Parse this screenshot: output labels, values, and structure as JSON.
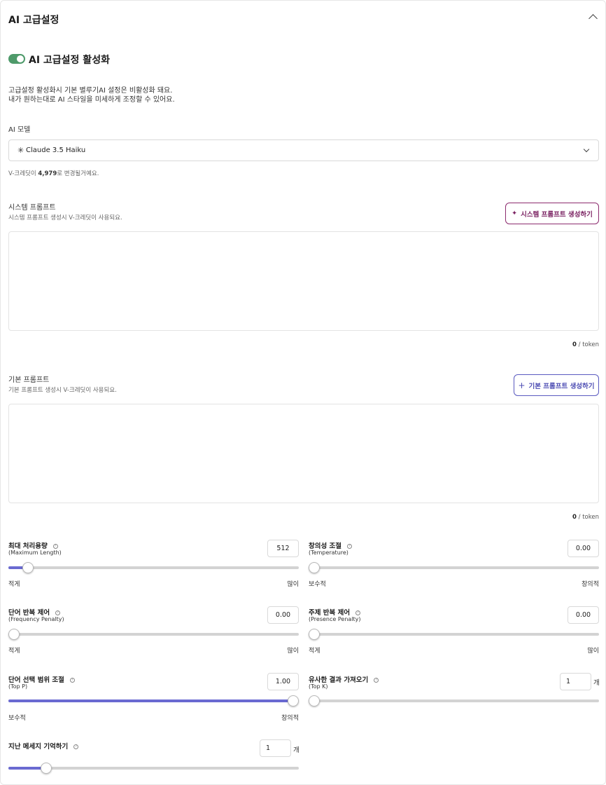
{
  "header": {
    "title": "AI 고급설정"
  },
  "toggle": {
    "label": "AI 고급설정 활성화",
    "on": true
  },
  "description": {
    "line1": "고급설정 활성화시 기본 별루기AI 설정은 비활성화 돼요.",
    "line2": "내가 원하는대로 AI 스타일을 미세하게 조정할 수 있어요."
  },
  "model": {
    "label": "AI 모델",
    "selected": "Claude 3.5 Haiku",
    "credit_prefix": "V-크레딧이 ",
    "credit_value": "4,979",
    "credit_suffix": "로 변경될거예요."
  },
  "system_prompt": {
    "label": "시스템 프롬프트",
    "hint": "시스템 프롬프트 생성시 V-크레딧이 사용되요.",
    "button": "시스템 프롬프트 생성하기",
    "value": "",
    "count": "0",
    "count_unit": " / token"
  },
  "base_prompt": {
    "label": "기본 프롬프트",
    "hint": "기본 프롬프트 생성시 V-크레딧이 사용되요.",
    "button": "기본 프롬프트 생성하기",
    "value": "",
    "count": "0",
    "count_unit": " / token"
  },
  "params": {
    "max_length": {
      "label": "최대 처리용량",
      "sub": "(Maximum Length)",
      "value": "512",
      "fraction": 0.05,
      "min_label": "적게",
      "max_label": "많이"
    },
    "temperature": {
      "label": "창의성 조절",
      "sub": "(Temperature)",
      "value": "0.00",
      "fraction": 0.0,
      "min_label": "보수적",
      "max_label": "창의적"
    },
    "frequency_penalty": {
      "label": "단어 반복 제어",
      "sub": "(Frequency Penalty)",
      "value": "0.00",
      "fraction": 0.0,
      "min_label": "적게",
      "max_label": "많이"
    },
    "presence_penalty": {
      "label": "주제 반복 제어",
      "sub": "(Presence Penalty)",
      "value": "0.00",
      "fraction": 0.0,
      "min_label": "적게",
      "max_label": "많이"
    },
    "top_p": {
      "label": "단어 선택 범위 조절",
      "sub": "(Top P)",
      "value": "1.00",
      "fraction": 1.0,
      "min_label": "보수적",
      "max_label": "창의적"
    },
    "top_k": {
      "label": "유사한 결과 가져오기",
      "sub": "(Top K)",
      "value": "1",
      "unit": "개",
      "fraction": 0.0
    },
    "memory": {
      "label": "지난 메세지 기억하기",
      "value": "1",
      "unit": "개",
      "fraction": 0.115
    }
  },
  "colors": {
    "toggle": "#4e9a6a",
    "slider_fill": "#6a6ad1",
    "system_button": "#7a2161",
    "base_button": "#4d4db3"
  }
}
